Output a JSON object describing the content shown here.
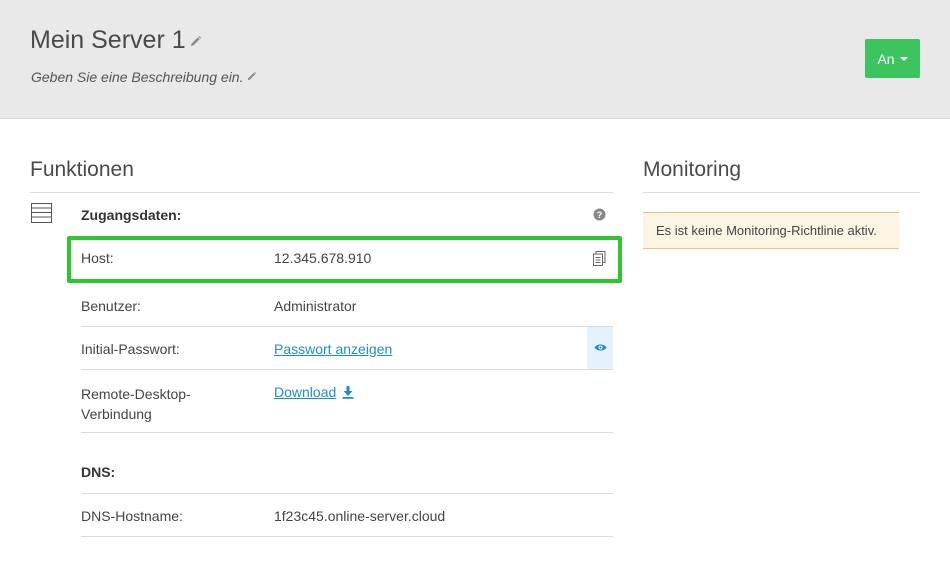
{
  "header": {
    "title": "Mein Server 1",
    "description": "Geben Sie eine Beschreibung ein.",
    "status_button": "An"
  },
  "functions": {
    "title": "Funktionen",
    "access": {
      "heading": "Zugangsdaten:",
      "host_label": "Host:",
      "host_value": "12.345.678.910",
      "user_label": "Benutzer:",
      "user_value": "Administrator",
      "password_label": "Initial-Passwort:",
      "password_link": "Passwort anzeigen",
      "rdp_label_line1": "Remote-Desktop-",
      "rdp_label_line2": "Verbindung",
      "rdp_link": "Download"
    },
    "dns": {
      "heading": "DNS:",
      "hostname_label": "DNS-Hostname:",
      "hostname_value": "1f23c45.online-server.cloud"
    }
  },
  "monitoring": {
    "title": "Monitoring",
    "alert": "Es ist keine Monitoring-Richtlinie aktiv."
  },
  "colors": {
    "accent_green": "#3cc45f",
    "highlight_green": "#2ec52e",
    "link_blue": "#1e8fc6",
    "alert_bg": "#fcf5e3",
    "alert_border": "#f2c178"
  }
}
